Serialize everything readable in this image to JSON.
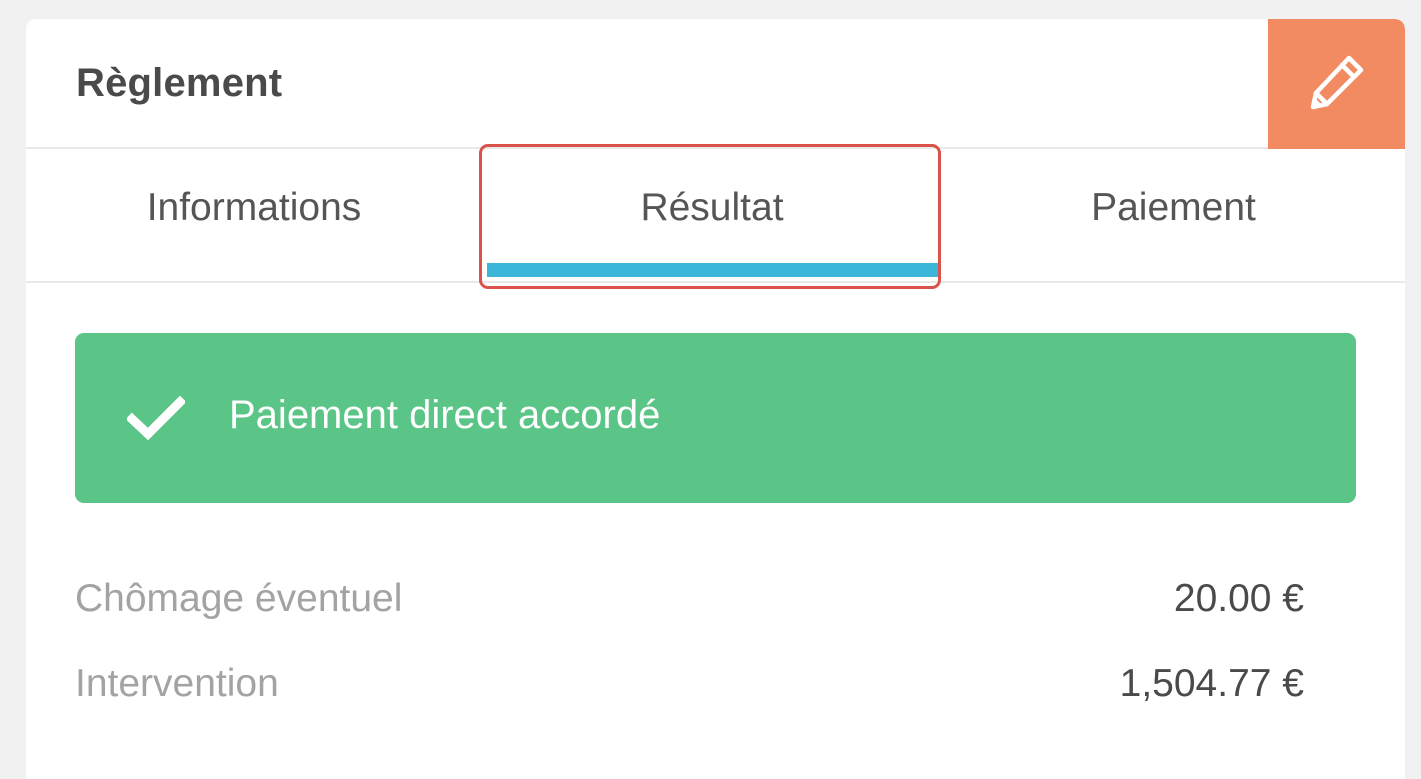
{
  "card": {
    "title": "Règlement"
  },
  "edit_button": {
    "icon": "pencil-icon",
    "color": "#f38b62"
  },
  "tabs": [
    {
      "label": "Informations",
      "active": false
    },
    {
      "label": "Résultat",
      "active": true
    },
    {
      "label": "Paiement",
      "active": false
    }
  ],
  "colors": {
    "active_tab_underline": "#3bb6d8",
    "highlight_border": "#d9534a",
    "success": "#5ac587"
  },
  "alert": {
    "icon": "check-icon",
    "message": "Paiement direct accordé"
  },
  "details": [
    {
      "label": "Chômage éventuel",
      "value": "20.00 €"
    },
    {
      "label": "Intervention",
      "value": "1,504.77 €"
    }
  ]
}
